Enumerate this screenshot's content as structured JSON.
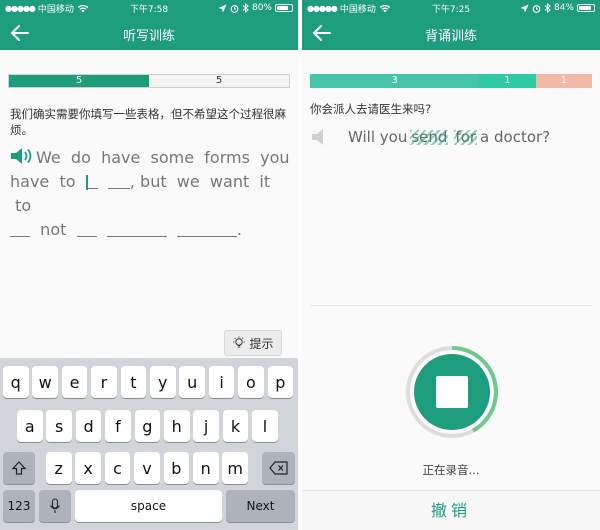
{
  "left": {
    "status": {
      "carrier": "中国移动",
      "time": "下午7:58",
      "battery": "80%",
      "battery_level": 0.8
    },
    "nav": {
      "title": "听写训练"
    },
    "progress": {
      "done": "5",
      "remaining": "5",
      "fraction": 0.5
    },
    "prompt": "我们确实需要你填写一些表格，但不希望这个过程很麻烦。",
    "sentence": {
      "w1": "We",
      "w2": "do",
      "w3": "have",
      "w4": "some",
      "w5": "forms",
      "w6": "you",
      "w7": "have",
      "w8": "to",
      "w9": ", but",
      "w10": "we",
      "w11": "want",
      "w12": "it",
      "w13": "to",
      "w14": "not",
      "end": "."
    },
    "hint": "提示",
    "keyboard": {
      "row1": [
        "q",
        "w",
        "e",
        "r",
        "t",
        "y",
        "u",
        "i",
        "o",
        "p"
      ],
      "row2": [
        "a",
        "s",
        "d",
        "f",
        "g",
        "h",
        "j",
        "k",
        "l"
      ],
      "row3": [
        "z",
        "x",
        "c",
        "v",
        "b",
        "n",
        "m"
      ],
      "num_label": "123",
      "space_label": "space",
      "next_label": "Next"
    }
  },
  "right": {
    "status": {
      "carrier": "中国移动",
      "time": "下午7:25",
      "battery": "84%",
      "battery_level": 0.84
    },
    "nav": {
      "title": "背诵训练"
    },
    "progress": {
      "seg1": "3",
      "seg2": "1",
      "seg3": "1"
    },
    "prompt": "你会派人去请医生来吗?",
    "sentence": {
      "a": "Will you",
      "hidden1": "send",
      "hidden2": "for",
      "b": "a doctor?"
    },
    "recording_status": "正在录音...",
    "undo": "撤销",
    "recording_progress": 0.42
  },
  "colors": {
    "accent": "#1e9d7d",
    "progress_a": "#45c4a8",
    "progress_b": "#2fcaa2",
    "progress_c": "#f1b9a6"
  }
}
